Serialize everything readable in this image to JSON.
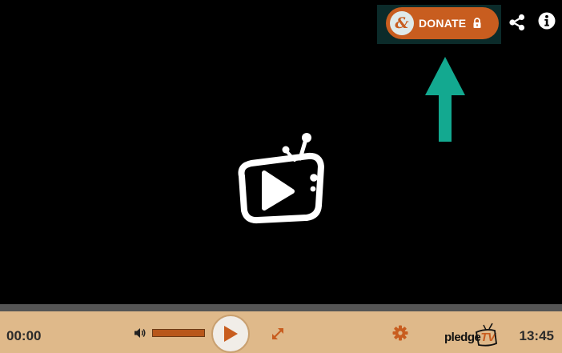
{
  "donate": {
    "label": "DONATE",
    "amp_glyph": "&"
  },
  "player": {
    "time_current": "00:00",
    "time_total": "13:45",
    "volume_level": 1.0,
    "progress": 0.0
  },
  "brand": {
    "text_main": "pledge",
    "text_tv": "TV"
  },
  "colors": {
    "accent": "#c85d1f",
    "control_bar": "#dfb98a",
    "arrow": "#13a990",
    "donate_bg": "#0b2b2a"
  },
  "icons": {
    "share": "share-icon",
    "info": "info-icon",
    "volume": "volume-icon",
    "play": "play-icon",
    "fullscreen": "fullscreen-icon",
    "settings": "gear-icon",
    "lock": "lock-icon"
  }
}
